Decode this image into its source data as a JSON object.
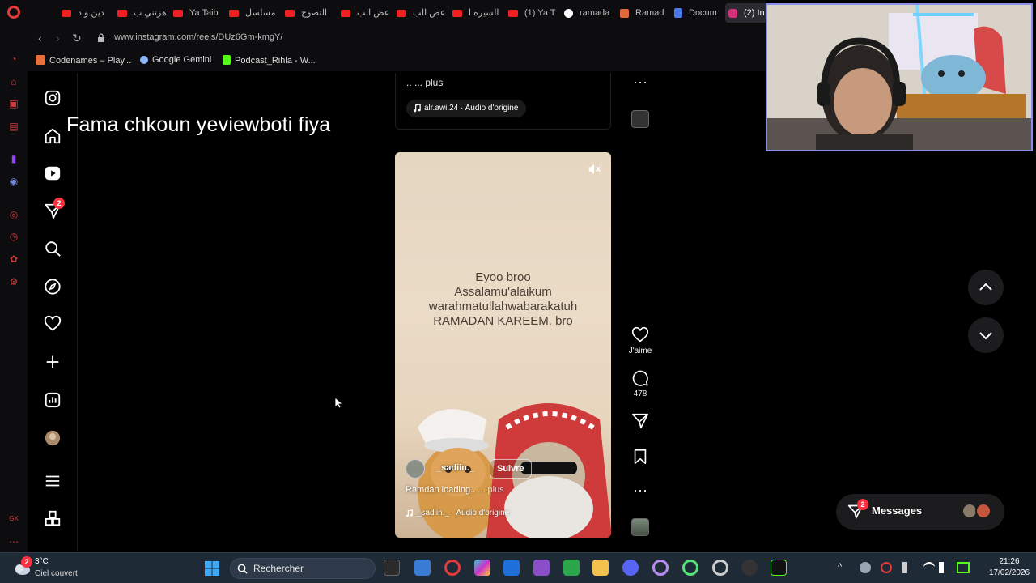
{
  "browser": {
    "tabs": [
      {
        "label": "دين و د",
        "favicon": "youtube-icon"
      },
      {
        "label": "هزتني ب",
        "favicon": "youtube-icon"
      },
      {
        "label": "Ya Taib",
        "favicon": "youtube-icon"
      },
      {
        "label": "مسلسل",
        "favicon": "youtube-icon"
      },
      {
        "label": "التصوح",
        "favicon": "youtube-icon"
      },
      {
        "label": "عض الب",
        "favicon": "youtube-icon"
      },
      {
        "label": "عض الب",
        "favicon": "youtube-icon"
      },
      {
        "label": "السيرة ا",
        "favicon": "youtube-icon"
      },
      {
        "label": "(1) Ya T",
        "favicon": "youtube-icon"
      },
      {
        "label": "ramada",
        "favicon": "google-icon"
      },
      {
        "label": "Ramad",
        "favicon": "gamma-icon"
      },
      {
        "label": "Docum",
        "favicon": "docs-icon"
      },
      {
        "label": "(2) In",
        "favicon": "instagram-icon",
        "active": true
      }
    ],
    "url": "www.instagram.com/reels/DUz6Gm-kmgY/",
    "bookmarks": [
      {
        "label": "Codenames – Play...",
        "icon": "codenames-icon",
        "color": "#e8703a"
      },
      {
        "label": "Google Gemini",
        "icon": "gemini-icon",
        "color": "#8ab4f8"
      },
      {
        "label": "Podcast_Rihla - W...",
        "icon": "kick-icon",
        "color": "#53fc18"
      }
    ]
  },
  "instagram": {
    "nav_badge_messages": "2",
    "overlay_caption": "Fama chkoun yeviewboti fiya",
    "previous_reel": {
      "more_text": ".. ... plus",
      "audio": "alr.awi.24 · Audio d'origine"
    },
    "reel": {
      "text_lines": [
        "Eyoo broo",
        "Assalamu'alaikum",
        "warahmatullahwabarakatuh",
        "RAMADAN KAREEM. bro"
      ],
      "username": "_sadiin._",
      "follow_label": "Suivre",
      "description": "Ramdan loading..",
      "more": " ... plus",
      "audio": "_sadiin._ · Audio d'origine"
    },
    "actions": {
      "like_label": "J'aime",
      "comments_count": "478"
    },
    "messages": {
      "label": "Messages",
      "badge": "2"
    }
  },
  "taskbar": {
    "weather_temp": "3°C",
    "weather_cond": "Ciel couvert",
    "weather_badge": "2",
    "search_placeholder": "Rechercher",
    "time": "21:26",
    "date": "17/02/2026"
  },
  "colors": {
    "accent_notification": "#ff3040",
    "opera_red": "#e23b3b",
    "webcam_border": "#8b8be8",
    "taskbar_bg": "#1f2a37"
  }
}
